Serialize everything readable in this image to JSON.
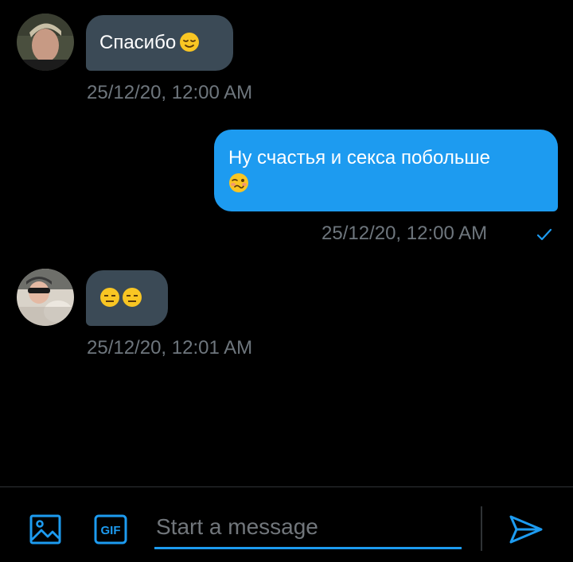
{
  "messages": [
    {
      "direction": "incoming",
      "text": "Спасибо",
      "emoji": "relieved-face",
      "timestamp": "25/12/20, 12:00 AM"
    },
    {
      "direction": "outgoing",
      "text": "Ну счастья и секса побольше",
      "emoji": "woozy-face",
      "timestamp": "25/12/20, 12:00 AM",
      "status_icon": "checkmark-icon"
    },
    {
      "direction": "incoming",
      "text": "",
      "emoji": "expressionless-face x2",
      "timestamp": "25/12/20, 12:01 AM"
    }
  ],
  "composer": {
    "placeholder": "Start a message",
    "value": "",
    "icons": [
      "image-icon",
      "gif-icon",
      "send-icon"
    ],
    "gif_label": "GIF"
  },
  "colors": {
    "background": "#000000",
    "incoming_bubble": "#3b4a56",
    "outgoing_bubble": "#1d9bf0",
    "accent": "#1d9bf0",
    "timestamp": "#6e767d"
  }
}
